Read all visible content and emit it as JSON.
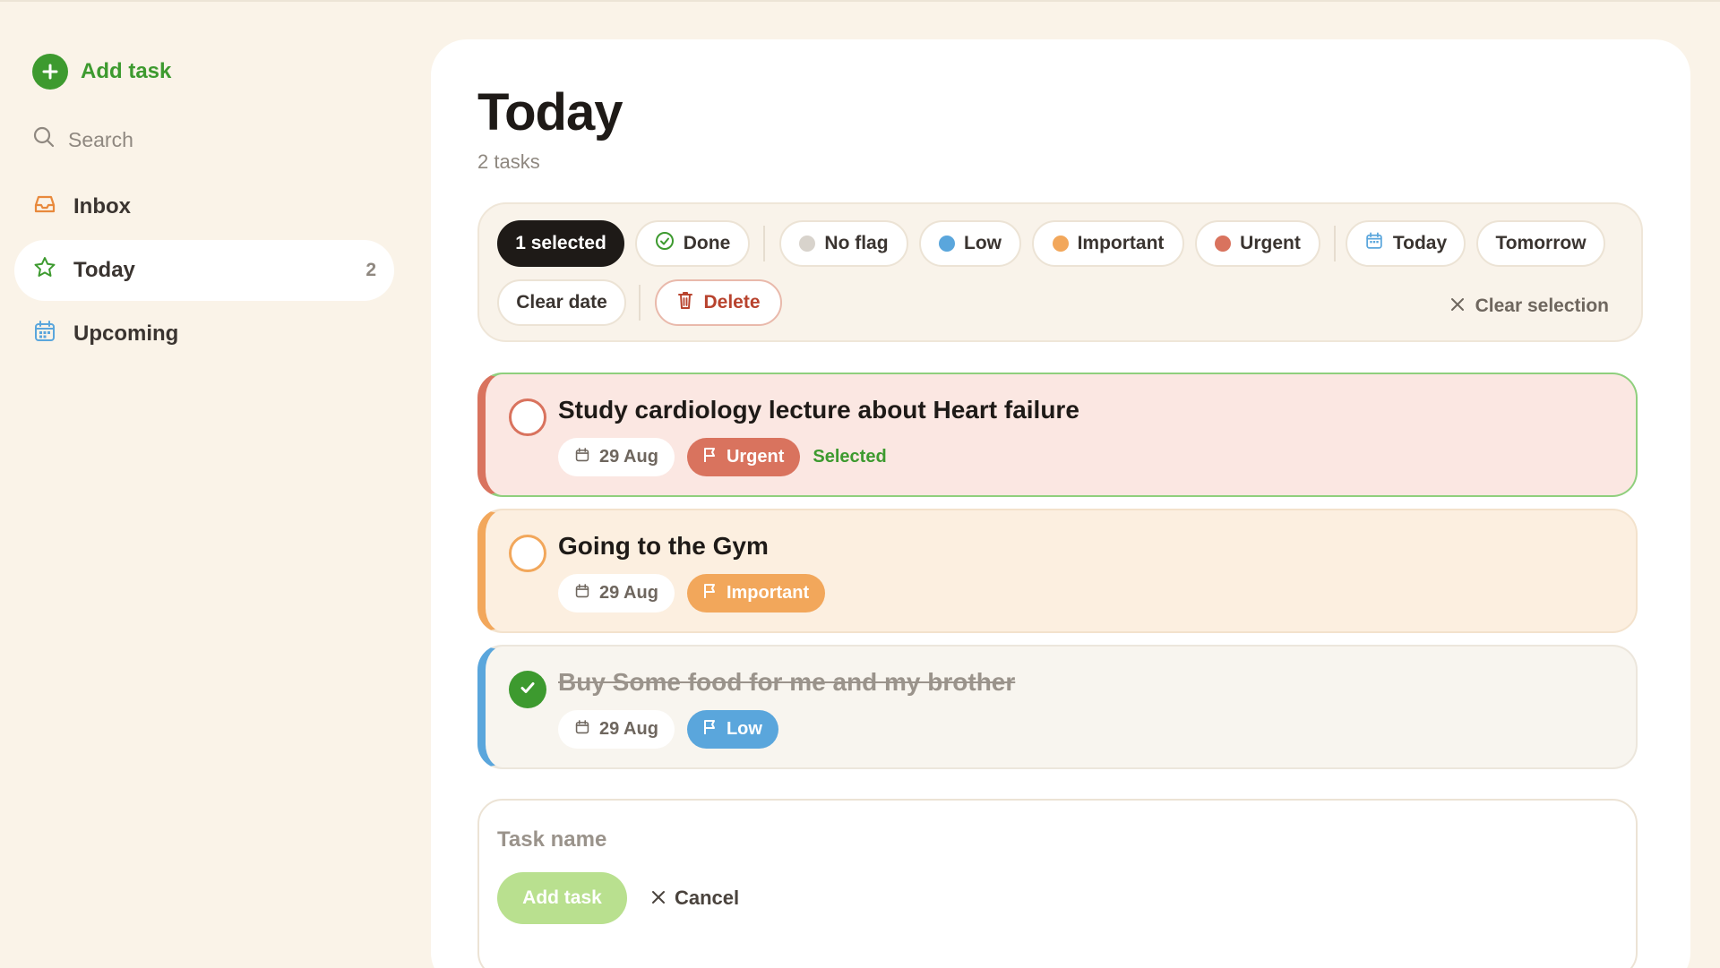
{
  "sidebar": {
    "add_task_label": "Add task",
    "search_placeholder": "Search",
    "items": [
      {
        "label": "Inbox",
        "icon": "inbox-icon",
        "count": ""
      },
      {
        "label": "Today",
        "icon": "star-icon",
        "count": "2",
        "active": true
      },
      {
        "label": "Upcoming",
        "icon": "calendar-icon",
        "count": ""
      }
    ]
  },
  "main": {
    "title": "Today",
    "subtitle": "2 tasks"
  },
  "bulk": {
    "selected_label": "1 selected",
    "done_label": "Done",
    "no_flag_label": "No flag",
    "low_label": "Low",
    "important_label": "Important",
    "urgent_label": "Urgent",
    "today_label": "Today",
    "tomorrow_label": "Tomorrow",
    "clear_date_label": "Clear date",
    "delete_label": "Delete",
    "clear_selection_label": "Clear selection"
  },
  "tasks": [
    {
      "title": "Study cardiology lecture about Heart failure",
      "date": "29 Aug",
      "flag": "Urgent",
      "selected_tag": "Selected",
      "done": false
    },
    {
      "title": "Going to the Gym",
      "date": "29 Aug",
      "flag": "Important",
      "done": false
    },
    {
      "title": "Buy Some food for me and my brother",
      "date": "29 Aug",
      "flag": "Low",
      "done": true
    }
  ],
  "new_task": {
    "placeholder": "Task name",
    "add_label": "Add task",
    "cancel_label": "Cancel"
  },
  "colors": {
    "accent_green": "#3d9a2f",
    "urgent": "#d9735e",
    "important": "#f2a75b",
    "low": "#5aa6dc",
    "no_flag": "#d8d3cc"
  }
}
